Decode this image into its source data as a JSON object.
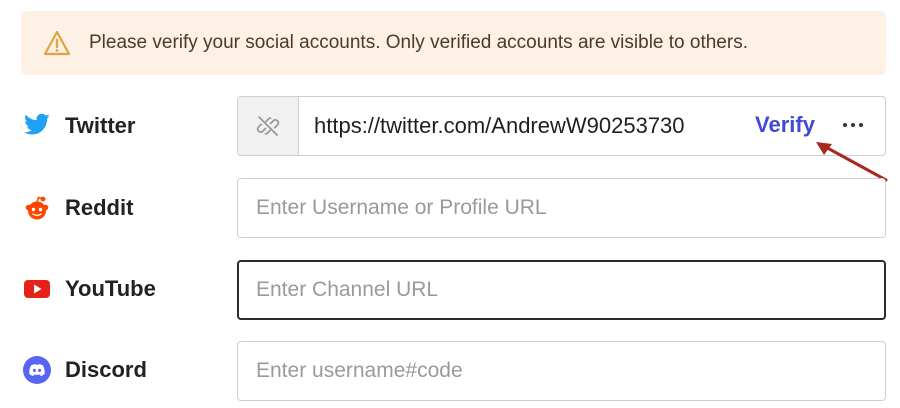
{
  "alert": {
    "text": "Please verify your social accounts. Only verified accounts are visible to others.",
    "icon": "warning-icon",
    "background": "#fcf1e4",
    "icon_color": "#e0a444"
  },
  "rows": {
    "twitter": {
      "label": "Twitter",
      "icon": "twitter-icon",
      "value": "https://twitter.com/AndrewW90253730",
      "verify_label": "Verify",
      "more_icon": "more-options-icon",
      "unlink_icon": "unlink-icon"
    },
    "reddit": {
      "label": "Reddit",
      "icon": "reddit-icon",
      "value": "",
      "placeholder": "Enter Username or Profile URL"
    },
    "youtube": {
      "label": "YouTube",
      "icon": "youtube-icon",
      "value": "",
      "placeholder": "Enter Channel URL"
    },
    "discord": {
      "label": "Discord",
      "icon": "discord-icon",
      "value": "",
      "placeholder": "Enter username#code"
    }
  },
  "colors": {
    "twitter": "#1da1f2",
    "reddit": "#ff4500",
    "youtube": "#e62117",
    "discord": "#5865f2",
    "verify": "#3f4bd1",
    "annotation_arrow": "#a52a1f"
  }
}
